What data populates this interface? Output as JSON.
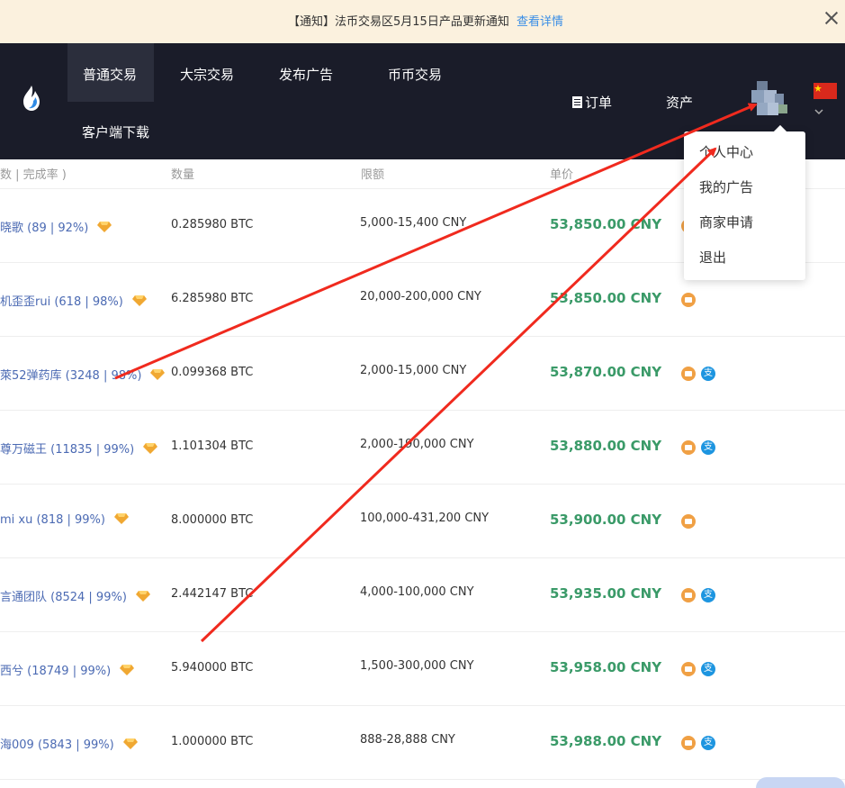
{
  "notice": {
    "text": "【通知】法币交易区5月15日产品更新通知",
    "link": "查看详情"
  },
  "nav": {
    "items": [
      "普通交易",
      "大宗交易",
      "发布广告",
      "币币交易",
      "客户端下载"
    ],
    "orders": "订单",
    "assets": "资产"
  },
  "table": {
    "headers": {
      "merchant": "数 | 完成率 )",
      "amount": "数量",
      "limit": "限额",
      "price": "单价"
    },
    "rows": [
      {
        "merchant": "晓歌 (89 | 92%)",
        "amount": "0.285980 BTC",
        "limit": "5,000-15,400 CNY",
        "price": "53,850.00 CNY",
        "alipay": false
      },
      {
        "merchant": "机歪歪rui (618 | 98%)",
        "amount": "6.285980 BTC",
        "limit": "20,000-200,000 CNY",
        "price": "53,850.00 CNY",
        "alipay": false
      },
      {
        "merchant": "萊52弹药库 (3248 | 98%)",
        "amount": "0.099368 BTC",
        "limit": "2,000-15,000 CNY",
        "price": "53,870.00 CNY",
        "alipay": true
      },
      {
        "merchant": "尊万磁王 (11835 | 99%)",
        "amount": "1.101304 BTC",
        "limit": "2,000-190,000 CNY",
        "price": "53,880.00 CNY",
        "alipay": true
      },
      {
        "merchant": "mi xu (818 | 99%)",
        "amount": "8.000000 BTC",
        "limit": "100,000-431,200 CNY",
        "price": "53,900.00 CNY",
        "alipay": false
      },
      {
        "merchant": "言通团队 (8524 | 99%)",
        "amount": "2.442147 BTC",
        "limit": "4,000-100,000 CNY",
        "price": "53,935.00 CNY",
        "alipay": true
      },
      {
        "merchant": "西兮 (18749 | 99%)",
        "amount": "5.940000 BTC",
        "limit": "1,500-300,000 CNY",
        "price": "53,958.00 CNY",
        "alipay": true
      },
      {
        "merchant": "海009 (5843 | 99%)",
        "amount": "1.000000 BTC",
        "limit": "888-28,888 CNY",
        "price": "53,988.00 CNY",
        "alipay": true
      }
    ],
    "alipay_glyph": "支"
  },
  "dropdown": {
    "items": [
      "个人中心",
      "我的广告",
      "商家申请",
      "退出"
    ]
  },
  "colors": {
    "accent_blue": "#3a8ee6",
    "nav_bg": "#1a1c29",
    "price_green": "#3a9a68",
    "arrow_red": "#f02a1e"
  },
  "icons": [
    "logo-icon",
    "close-icon",
    "order-icon",
    "avatar",
    "china-flag-icon",
    "chevron-down-icon",
    "diamond-icon",
    "bank-card-icon",
    "alipay-icon"
  ]
}
